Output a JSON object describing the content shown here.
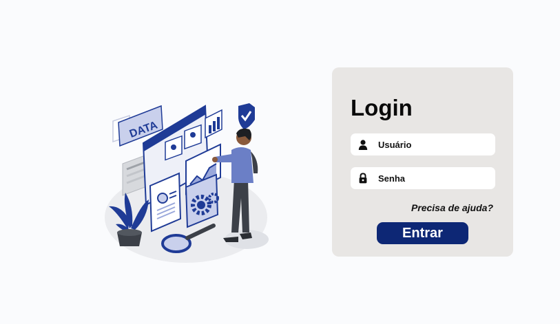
{
  "login": {
    "title": "Login",
    "username_placeholder": "Usuário",
    "password_placeholder": "Senha",
    "help_link": "Precisa de ajuda?",
    "submit_label": "Entrar"
  },
  "illustration": {
    "sign_text": "DATA"
  },
  "colors": {
    "background": "#fafbfd",
    "card": "#e8e6e4",
    "accent": "#0d2775",
    "field": "#ffffff"
  }
}
